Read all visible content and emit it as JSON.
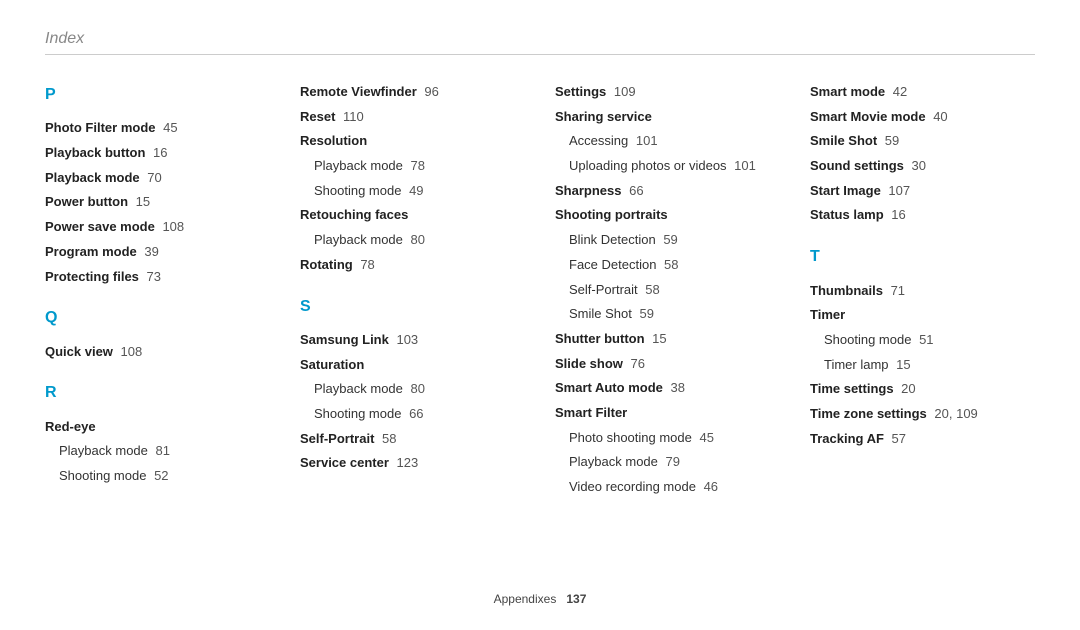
{
  "header": {
    "title": "Index"
  },
  "footer": {
    "section": "Appendixes",
    "page": "137"
  },
  "columns": [
    {
      "groups": [
        {
          "letter": "P",
          "entries": [
            {
              "label": "Photo Filter mode",
              "page": "45"
            },
            {
              "label": "Playback button",
              "page": "16"
            },
            {
              "label": "Playback mode",
              "page": "70"
            },
            {
              "label": "Power button",
              "page": "15"
            },
            {
              "label": "Power save mode",
              "page": "108"
            },
            {
              "label": "Program mode",
              "page": "39"
            },
            {
              "label": "Protecting files",
              "page": "73"
            }
          ]
        },
        {
          "letter": "Q",
          "entries": [
            {
              "label": "Quick view",
              "page": "108"
            }
          ]
        },
        {
          "letter": "R",
          "entries": [
            {
              "label": "Red-eye",
              "subs": [
                {
                  "label": "Playback mode",
                  "page": "81"
                },
                {
                  "label": "Shooting mode",
                  "page": "52"
                }
              ]
            }
          ]
        }
      ]
    },
    {
      "groups": [
        {
          "letter": "",
          "entries": [
            {
              "label": "Remote Viewfinder",
              "page": "96"
            },
            {
              "label": "Reset",
              "page": "110"
            },
            {
              "label": "Resolution",
              "subs": [
                {
                  "label": "Playback mode",
                  "page": "78"
                },
                {
                  "label": "Shooting mode",
                  "page": "49"
                }
              ]
            },
            {
              "label": "Retouching faces",
              "subs": [
                {
                  "label": "Playback mode",
                  "page": "80"
                }
              ]
            },
            {
              "label": "Rotating",
              "page": "78"
            }
          ]
        },
        {
          "letter": "S",
          "entries": [
            {
              "label": "Samsung Link",
              "page": "103"
            },
            {
              "label": "Saturation",
              "subs": [
                {
                  "label": "Playback mode",
                  "page": "80"
                },
                {
                  "label": "Shooting mode",
                  "page": "66"
                }
              ]
            },
            {
              "label": "Self-Portrait",
              "page": "58"
            },
            {
              "label": "Service center",
              "page": "123"
            }
          ]
        }
      ]
    },
    {
      "groups": [
        {
          "letter": "",
          "entries": [
            {
              "label": "Settings",
              "page": "109"
            },
            {
              "label": "Sharing service",
              "subs": [
                {
                  "label": "Accessing",
                  "page": "101"
                },
                {
                  "label": "Uploading photos or videos",
                  "page": "101"
                }
              ]
            },
            {
              "label": "Sharpness",
              "page": "66"
            },
            {
              "label": "Shooting portraits",
              "subs": [
                {
                  "label": "Blink Detection",
                  "page": "59"
                },
                {
                  "label": "Face Detection",
                  "page": "58"
                },
                {
                  "label": "Self-Portrait",
                  "page": "58"
                },
                {
                  "label": "Smile Shot",
                  "page": "59"
                }
              ]
            },
            {
              "label": "Shutter button",
              "page": "15"
            },
            {
              "label": "Slide show",
              "page": "76"
            },
            {
              "label": "Smart Auto mode",
              "page": "38"
            },
            {
              "label": "Smart Filter",
              "subs": [
                {
                  "label": "Photo shooting mode",
                  "page": "45"
                },
                {
                  "label": "Playback mode",
                  "page": "79"
                },
                {
                  "label": "Video recording mode",
                  "page": "46"
                }
              ]
            }
          ]
        }
      ]
    },
    {
      "groups": [
        {
          "letter": "",
          "entries": [
            {
              "label": "Smart mode",
              "page": "42"
            },
            {
              "label": "Smart Movie mode",
              "page": "40"
            },
            {
              "label": "Smile Shot",
              "page": "59"
            },
            {
              "label": "Sound settings",
              "page": "30"
            },
            {
              "label": "Start Image",
              "page": "107"
            },
            {
              "label": "Status lamp",
              "page": "16"
            }
          ]
        },
        {
          "letter": "T",
          "entries": [
            {
              "label": "Thumbnails",
              "page": "71"
            },
            {
              "label": "Timer",
              "subs": [
                {
                  "label": "Shooting mode",
                  "page": "51"
                },
                {
                  "label": "Timer lamp",
                  "page": "15"
                }
              ]
            },
            {
              "label": "Time settings",
              "page": "20"
            },
            {
              "label": "Time zone settings",
              "page": "20, 109"
            },
            {
              "label": "Tracking AF",
              "page": "57"
            }
          ]
        }
      ]
    }
  ]
}
